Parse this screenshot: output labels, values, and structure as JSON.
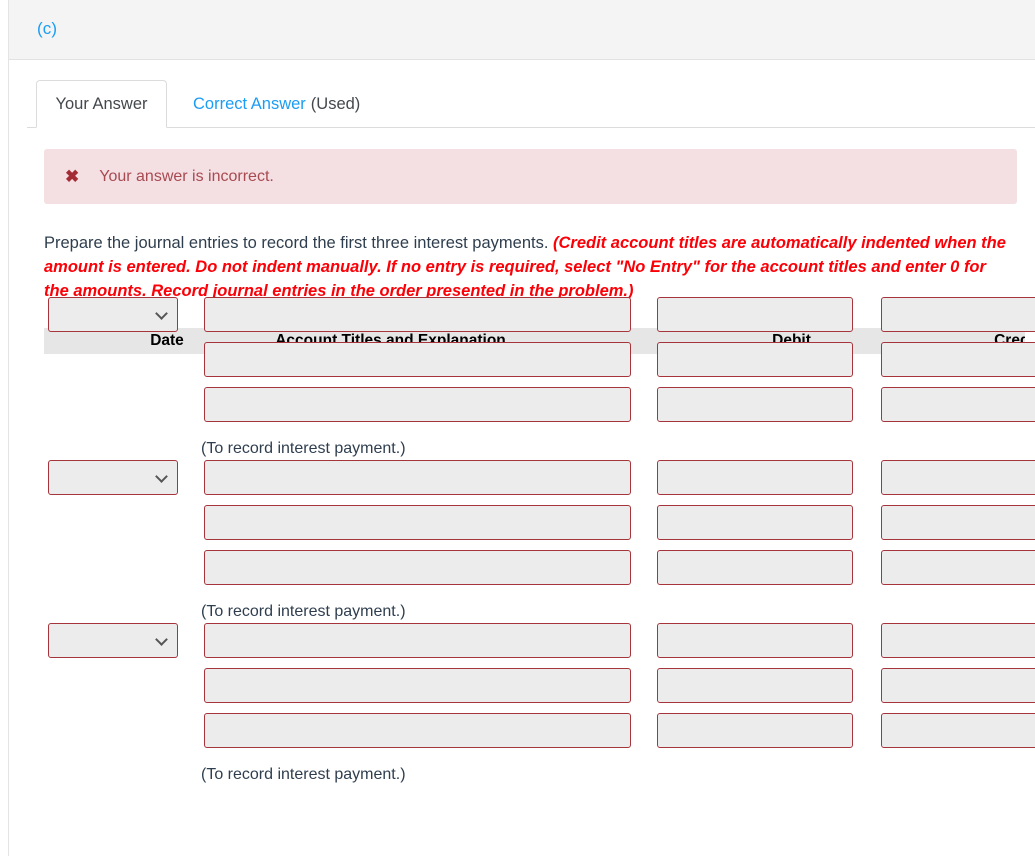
{
  "header": {
    "part_label": "(c)"
  },
  "tabs": [
    {
      "label": "Your Answer",
      "active": true
    },
    {
      "label": "Correct Answer",
      "suffix": "(Used)",
      "active": false
    }
  ],
  "alert": {
    "icon": "x-mark-icon",
    "glyph": "✖",
    "message": "Your answer is incorrect.",
    "background_color": "#f4dfe2",
    "text_color": "#a84a52"
  },
  "instruction": {
    "lead": "Prepare the journal entries to record the first three interest payments. ",
    "emphasis": "(Credit account titles are automatically indented when the amount is entered. Do not indent manually. If no entry is required, select \"No Entry\" for the account titles and enter 0 for the amounts. Record journal entries in the order presented in the problem.)",
    "emphasis_color": "#fb0007"
  },
  "table": {
    "columns": {
      "date": "Date",
      "account": "Account Titles and Explanation",
      "debit": "Debit",
      "credit": "Credit"
    },
    "header_background": "#e6e6e6",
    "field_border_color": "#a6343b",
    "field_background": "#ececec",
    "entries": [
      {
        "date_value": "",
        "date_placeholder": "",
        "rows": [
          {
            "account": "",
            "debit": "",
            "credit": ""
          },
          {
            "account": "",
            "debit": "",
            "credit": ""
          },
          {
            "account": "",
            "debit": "",
            "credit": ""
          }
        ],
        "memo": "(To record interest payment.)"
      },
      {
        "date_value": "",
        "date_placeholder": "",
        "rows": [
          {
            "account": "",
            "debit": "",
            "credit": ""
          },
          {
            "account": "",
            "debit": "",
            "credit": ""
          },
          {
            "account": "",
            "debit": "",
            "credit": ""
          }
        ],
        "memo": "(To record interest payment.)"
      },
      {
        "date_value": "",
        "date_placeholder": "",
        "rows": [
          {
            "account": "",
            "debit": "",
            "credit": ""
          },
          {
            "account": "",
            "debit": "",
            "credit": ""
          },
          {
            "account": "",
            "debit": "",
            "credit": ""
          }
        ],
        "memo": "(To record interest payment.)"
      }
    ]
  }
}
